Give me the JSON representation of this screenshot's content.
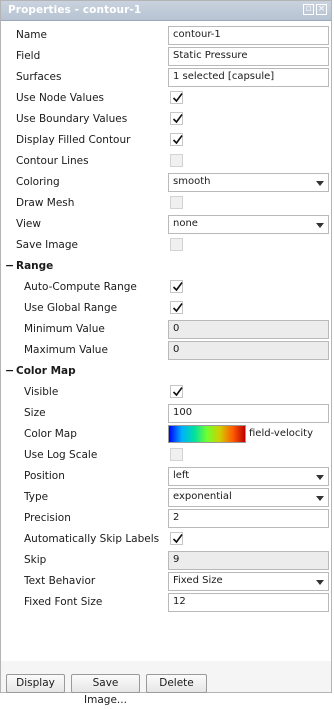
{
  "title": "Properties - contour-1",
  "general": {
    "name_label": "Name",
    "name_value": "contour-1",
    "field_label": "Field",
    "field_value": "Static Pressure",
    "surfaces_label": "Surfaces",
    "surfaces_value": "1 selected [capsule]",
    "use_node_values_label": "Use Node Values",
    "use_node_values_checked": true,
    "use_boundary_values_label": "Use Boundary Values",
    "use_boundary_values_checked": true,
    "display_filled_contour_label": "Display Filled Contour",
    "display_filled_contour_checked": true,
    "contour_lines_label": "Contour Lines",
    "contour_lines_checked": false,
    "coloring_label": "Coloring",
    "coloring_value": "smooth",
    "draw_mesh_label": "Draw Mesh",
    "draw_mesh_checked": false,
    "view_label": "View",
    "view_value": "none",
    "save_image_label": "Save Image",
    "save_image_checked": false
  },
  "range": {
    "header": "Range",
    "auto_compute_label": "Auto-Compute Range",
    "auto_compute_checked": true,
    "use_global_label": "Use Global Range",
    "use_global_checked": true,
    "min_label": "Minimum Value",
    "min_value": "0",
    "max_label": "Maximum Value",
    "max_value": "0"
  },
  "color_map": {
    "header": "Color Map",
    "visible_label": "Visible",
    "visible_checked": true,
    "size_label": "Size",
    "size_value": "100",
    "colormap_label": "Color Map",
    "colormap_name": "field-velocity",
    "colormap_colors": [
      "#0000ff",
      "#00b0ff",
      "#00e0a0",
      "#70ff30",
      "#d0d000",
      "#ff6000",
      "#c00000"
    ],
    "log_scale_label": "Use Log Scale",
    "log_scale_checked": false,
    "position_label": "Position",
    "position_value": "left",
    "type_label": "Type",
    "type_value": "exponential",
    "precision_label": "Precision",
    "precision_value": "2",
    "auto_skip_label": "Automatically Skip Labels",
    "auto_skip_checked": true,
    "skip_label": "Skip",
    "skip_value": "9",
    "text_behavior_label": "Text Behavior",
    "text_behavior_value": "Fixed Size",
    "fixed_font_size_label": "Fixed Font Size",
    "fixed_font_size_value": "12"
  },
  "buttons": {
    "display": "Display",
    "save_image": "Save Image...",
    "delete": "Delete"
  },
  "colors": {
    "titlebar": "#b7c3d2",
    "panel_bg": "#f5f5f5",
    "readonly_bg": "#ececec"
  }
}
